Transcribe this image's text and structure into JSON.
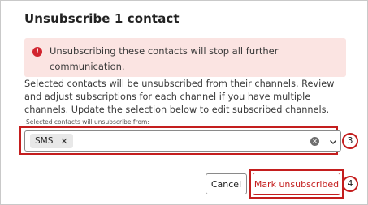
{
  "dialog": {
    "title": "Unsubscribe 1 contact",
    "alert": {
      "icon": "alert-circle-icon",
      "text": "Unsubscribing these contacts will stop all further communication."
    },
    "description": "Selected contacts will be unsubscribed from their channels. Review and adjust subscriptions for each channel if you have multiple channels. Update the selection below to edit subscribed channels.",
    "field": {
      "label": "Selected contacts will unsubscribe from:",
      "chips": [
        {
          "label": "SMS"
        }
      ],
      "clear_icon": "clear-circle-icon",
      "chevron_icon": "chevron-down-icon"
    },
    "buttons": {
      "cancel": "Cancel",
      "mark_unsubscribed": "Mark unsubscribed"
    },
    "annotations": {
      "select_marker": "3",
      "button_marker": "4",
      "color": "#c41e1e"
    }
  }
}
